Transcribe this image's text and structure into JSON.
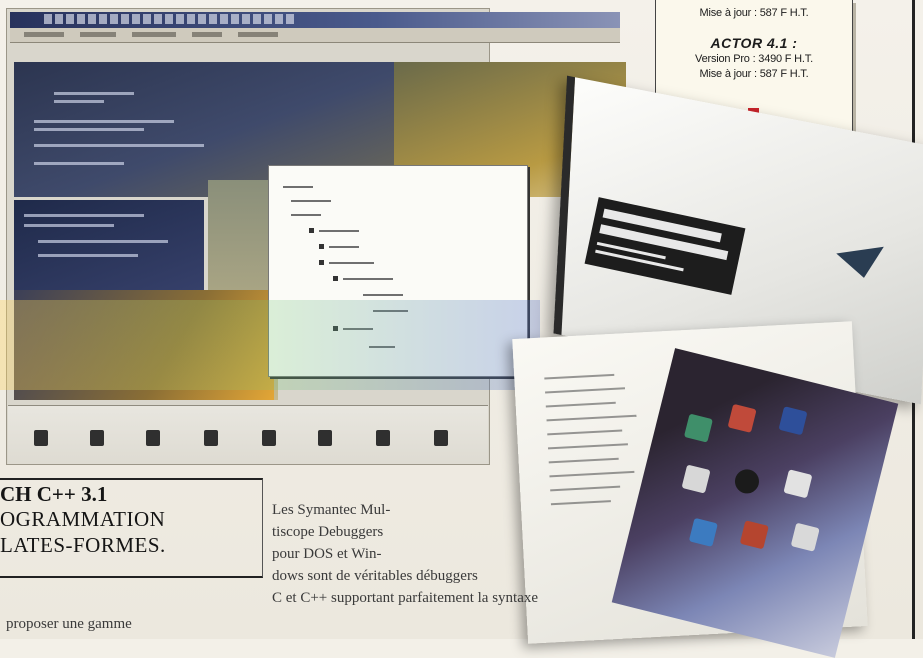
{
  "price_box": {
    "lines_top": [
      "Mise à jour : 587 F H.T."
    ],
    "product_name": "ACTOR 4.1 :",
    "lines": [
      "Version Pro : 3490 F H.T.",
      "Mise à jour : 587 F H.T."
    ],
    "accent": "#c9242b"
  },
  "article": {
    "headline": [
      "CH C++ 3.1",
      "OGRAMMATION",
      "LATES-FORMES."
    ],
    "left_column": [
      "proposer une gamme"
    ],
    "right_column": [
      "Les Symantec Mul-",
      "tiscope Debuggers",
      "pour DOS et Win-",
      "dows sont de véritables débuggers",
      "C et C++ supportant parfaitement la syntaxe"
    ]
  }
}
